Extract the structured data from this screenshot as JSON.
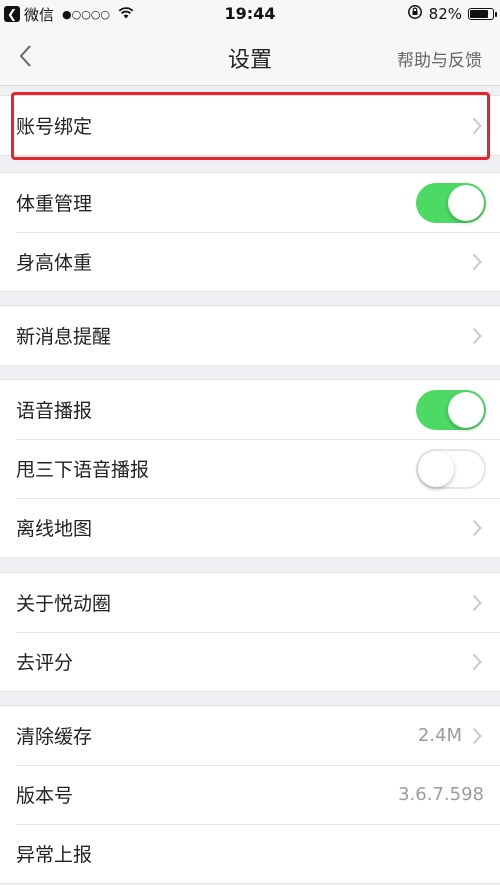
{
  "status_bar": {
    "back_app": "微信",
    "signal": "●○○○○",
    "time": "19:44",
    "battery": "82%",
    "battery_level": 0.82
  },
  "nav": {
    "title": "设置",
    "right_link": "帮助与反馈"
  },
  "groups": [
    {
      "rows": [
        {
          "label": "账号绑定"
        }
      ]
    },
    {
      "rows": [
        {
          "label": "体重管理",
          "toggle": "on"
        },
        {
          "label": "身高体重"
        }
      ]
    },
    {
      "rows": [
        {
          "label": "新消息提醒"
        }
      ]
    },
    {
      "rows": [
        {
          "label": "语音播报",
          "toggle": "on"
        },
        {
          "label": "甩三下语音播报",
          "toggle": "off"
        },
        {
          "label": "离线地图"
        }
      ]
    },
    {
      "rows": [
        {
          "label": "关于悦动圈"
        },
        {
          "label": "去评分"
        }
      ]
    },
    {
      "rows": [
        {
          "label": "清除缓存",
          "value": "2.4M"
        },
        {
          "label": "版本号",
          "value": "3.6.7.598"
        },
        {
          "label": "异常上报"
        }
      ]
    }
  ],
  "colors": {
    "toggle_on": "#4cd964",
    "highlight": "#e8232a",
    "background": "#efeff4"
  }
}
